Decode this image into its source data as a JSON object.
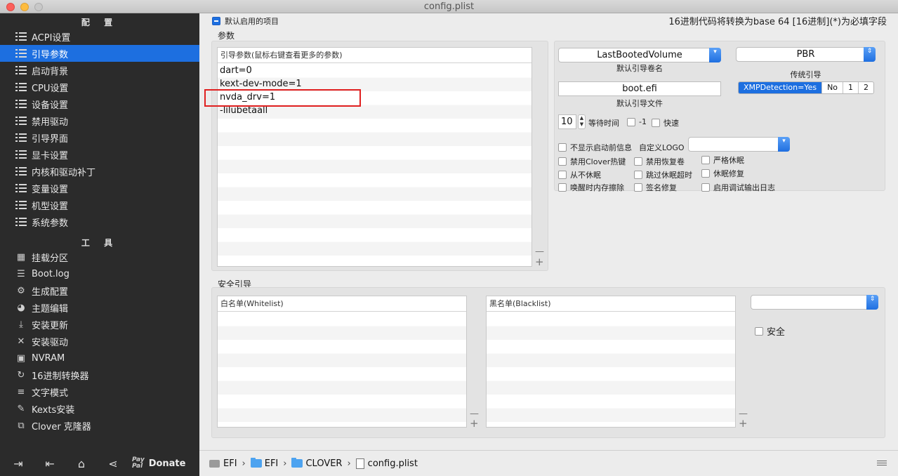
{
  "window": {
    "title": "config.plist"
  },
  "sidebar": {
    "config_header": "配 置",
    "config_items": [
      {
        "label": "ACPI设置"
      },
      {
        "label": "引导参数"
      },
      {
        "label": "启动背景"
      },
      {
        "label": "CPU设置"
      },
      {
        "label": "设备设置"
      },
      {
        "label": "禁用驱动"
      },
      {
        "label": "引导界面"
      },
      {
        "label": "显卡设置"
      },
      {
        "label": "内核和驱动补丁"
      },
      {
        "label": "变量设置"
      },
      {
        "label": "机型设置"
      },
      {
        "label": "系统参数"
      }
    ],
    "tools_header": "工 具",
    "tool_items": [
      {
        "label": "挂载分区",
        "icon": "partition-icon"
      },
      {
        "label": "Boot.log",
        "icon": "log-icon"
      },
      {
        "label": "生成配置",
        "icon": "generate-icon"
      },
      {
        "label": "主题编辑",
        "icon": "palette-icon"
      },
      {
        "label": "安装更新",
        "icon": "download-icon"
      },
      {
        "label": "安装驱动",
        "icon": "wrench-icon"
      },
      {
        "label": "NVRAM",
        "icon": "chip-icon"
      },
      {
        "label": "16进制转换器",
        "icon": "convert-icon"
      },
      {
        "label": "文字模式",
        "icon": "text-icon"
      },
      {
        "label": "Kexts安装",
        "icon": "plug-icon"
      },
      {
        "label": "Clover 克隆器",
        "icon": "clone-icon"
      }
    ],
    "footer": {
      "donate_label": "Donate",
      "paypal_top": "Pay",
      "paypal_bottom": "Pal"
    }
  },
  "header": {
    "default_enabled_label": "默认启用的项目",
    "hint": "16进制代码将转换为base 64 [16进制](*)为必填字段"
  },
  "params": {
    "group_label": "参数",
    "list_header": "引导参数(鼠标右键查看更多的参数)",
    "args": [
      "dart=0",
      "kext-dev-mode=1",
      "nvda_drv=1",
      "-lilubetaall"
    ],
    "minus": "—",
    "plus": "+"
  },
  "boot": {
    "default_volume": "LastBootedVolume",
    "default_volume_label": "默认引导卷名",
    "legacy_value": "PBR",
    "legacy_label": "传统引导",
    "xmp_options": [
      "XMPDetection=Yes",
      "No",
      "1",
      "2"
    ],
    "xmp_selected": 0,
    "default_loader": "boot.efi",
    "default_loader_label": "默认引导文件",
    "timeout_value": "10",
    "timeout_label": "等待时间",
    "minus_one_label": "-1",
    "fast_label": "快速",
    "no_early_progress": "不显示启动前信息",
    "custom_logo_label": "自定义LOGO",
    "checks": [
      {
        "label": "禁用Clover热键"
      },
      {
        "label": "禁用恢复卷"
      },
      {
        "label": "严格休眠"
      },
      {
        "label": "从不休眠"
      },
      {
        "label": "跳过休眠超时"
      },
      {
        "label": "休眠修复"
      },
      {
        "label": "唤醒时内存擦除"
      },
      {
        "label": "签名修复"
      },
      {
        "label": "启用调试输出日志"
      }
    ]
  },
  "secure_boot": {
    "group_label": "安全引导",
    "whitelist_header": "白名单(Whitelist)",
    "blacklist_header": "黑名单(Blacklist)",
    "secure_label": "安全",
    "minus": "—",
    "plus": "+"
  },
  "pathbar": {
    "crumbs": [
      "EFI",
      "EFI",
      "CLOVER",
      "config.plist"
    ],
    "separator": "›"
  }
}
